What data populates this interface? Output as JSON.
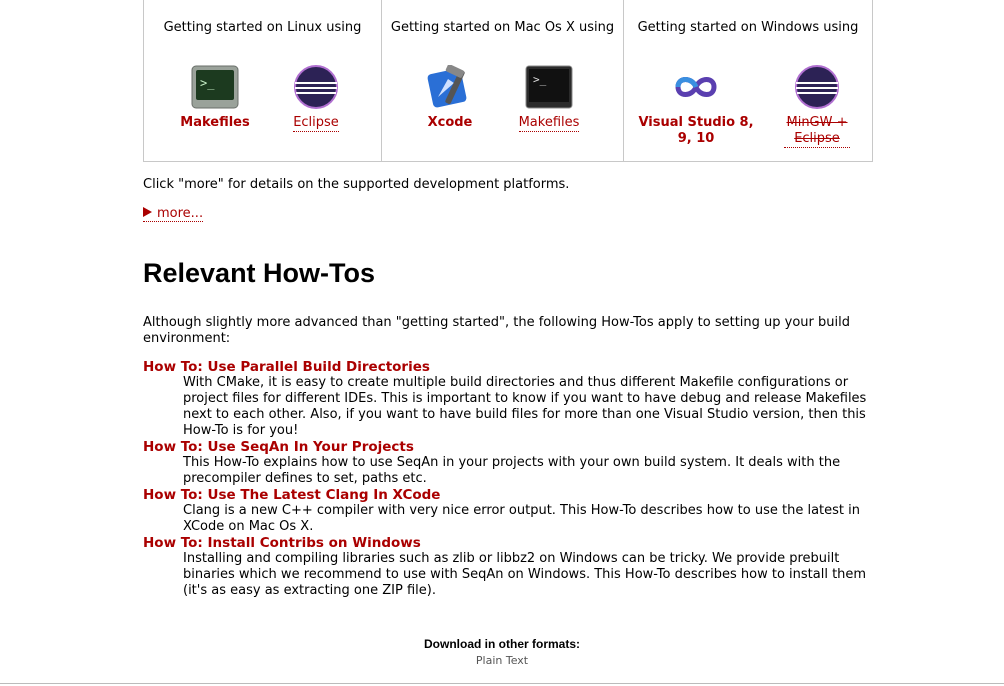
{
  "platforms": [
    {
      "heading": "Getting started on Linux using",
      "tools": [
        {
          "label": "Makefiles",
          "icon": "terminal-icon"
        },
        {
          "label": "Eclipse",
          "icon": "eclipse-icon"
        }
      ]
    },
    {
      "heading": "Getting started on Mac Os X using",
      "tools": [
        {
          "label": "Xcode",
          "icon": "xcode-icon"
        },
        {
          "label": "Makefiles",
          "icon": "terminal-icon"
        }
      ]
    },
    {
      "heading": "Getting started on Windows using",
      "tools": [
        {
          "label": "Visual Studio 8, 9, 10",
          "icon": "visual-studio-icon"
        },
        {
          "label": "MinGW + Eclipse",
          "icon": "eclipse-icon"
        }
      ]
    }
  ],
  "intro": "Click \"more\" for details on the supported development platforms.",
  "more_label": "more...",
  "section_title": "Relevant How-Tos",
  "lead": "Although slightly more advanced than \"getting started\", the following How-Tos apply to setting up your build environment:",
  "howtos": [
    {
      "title": "How To: Use Parallel Build Directories",
      "desc": "With CMake, it is easy to create multiple build directories and thus different Makefile configurations or project files for different IDEs. This is important to know if you want to have debug and release Makefiles next to each other. Also, if you want to have build files for more than one Visual Studio version, then this How-To is for you!"
    },
    {
      "title": "How To: Use SeqAn In Your Projects",
      "desc": "This How-To explains how to use SeqAn in your projects with your own build system. It deals with the precompiler defines to set, paths etc."
    },
    {
      "title": "How To: Use The Latest Clang In XCode",
      "desc": "Clang is a new C++ compiler with very nice error output. This How-To describes how to use the latest in XCode on Mac Os X."
    },
    {
      "title": "How To: Install Contribs on Windows",
      "desc": "Installing and compiling libraries such as zlib or libbz2 on Windows can be tricky. We provide prebuilt binaries which we recommend to use with SeqAn on Windows. This How-To describes how to install them (it's as easy as extracting one ZIP file)."
    }
  ],
  "download_label": "Download in other formats:",
  "plain_text_label": "Plain Text",
  "colors": {
    "link": "#aa0000",
    "border": "#c8c8c8"
  }
}
